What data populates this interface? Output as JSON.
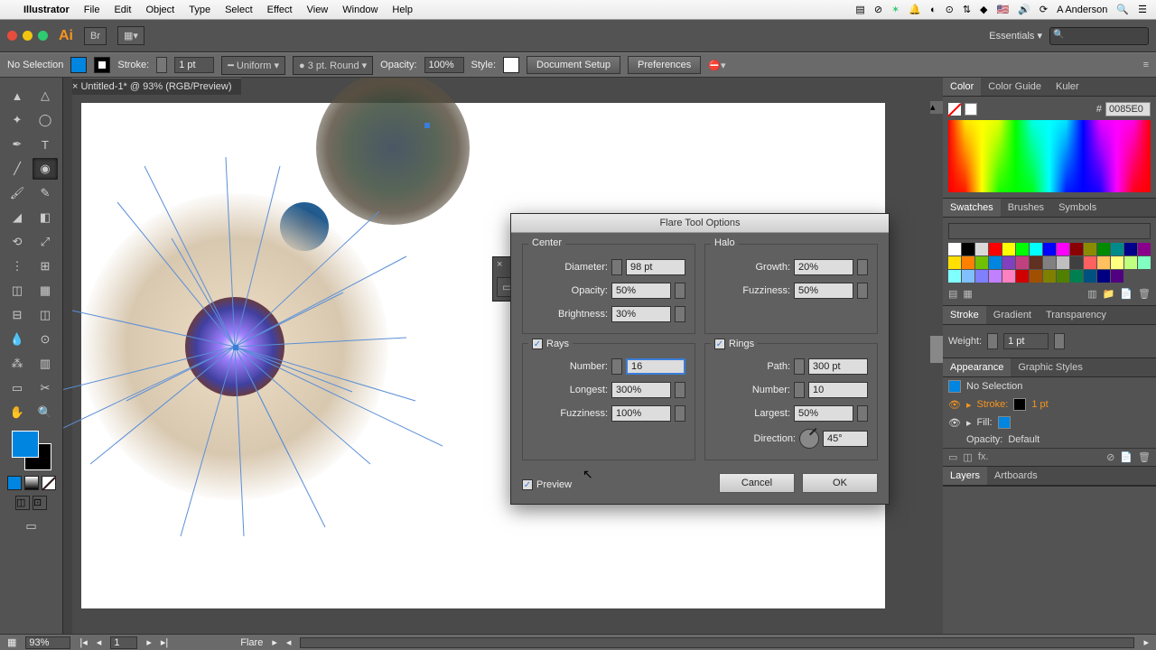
{
  "mac_menu": {
    "app": "Illustrator",
    "items": [
      "File",
      "Edit",
      "Object",
      "Type",
      "Select",
      "Effect",
      "View",
      "Window",
      "Help"
    ],
    "user": "A Anderson"
  },
  "app_toolbar": {
    "workspace": "Essentials"
  },
  "control_bar": {
    "selection": "No Selection",
    "stroke_label": "Stroke:",
    "stroke_weight": "1 pt",
    "stroke_style": "Uniform",
    "brush": "3 pt. Round",
    "opacity_label": "Opacity:",
    "opacity": "100%",
    "style_label": "Style:",
    "doc_setup": "Document Setup",
    "prefs": "Preferences"
  },
  "doc": {
    "tab": "Untitled-1* @ 93% (RGB/Preview)"
  },
  "dialog": {
    "title": "Flare Tool Options",
    "center": {
      "legend": "Center",
      "diameter_label": "Diameter:",
      "diameter": "98 pt",
      "opacity_label": "Opacity:",
      "opacity": "50%",
      "brightness_label": "Brightness:",
      "brightness": "30%"
    },
    "halo": {
      "legend": "Halo",
      "growth_label": "Growth:",
      "growth": "20%",
      "fuzziness_label": "Fuzziness:",
      "fuzziness": "50%"
    },
    "rays": {
      "legend": "Rays",
      "checked": true,
      "number_label": "Number:",
      "number": "16",
      "longest_label": "Longest:",
      "longest": "300%",
      "fuzziness_label": "Fuzziness:",
      "fuzziness": "100%"
    },
    "rings": {
      "legend": "Rings",
      "checked": true,
      "path_label": "Path:",
      "path": "300 pt",
      "number_label": "Number:",
      "number": "10",
      "largest_label": "Largest:",
      "largest": "50%",
      "direction_label": "Direction:",
      "direction": "45°"
    },
    "preview_label": "Preview",
    "cancel": "Cancel",
    "ok": "OK"
  },
  "panels": {
    "color": {
      "tabs": [
        "Color",
        "Color Guide",
        "Kuler"
      ],
      "hex": "0085E0"
    },
    "swatches": {
      "tabs": [
        "Swatches",
        "Brushes",
        "Symbols"
      ]
    },
    "stroke": {
      "tabs": [
        "Stroke",
        "Gradient",
        "Transparency"
      ],
      "weight_label": "Weight:",
      "weight": "1 pt"
    },
    "appearance": {
      "tabs": [
        "Appearance",
        "Graphic Styles"
      ],
      "selection": "No Selection",
      "stroke_label": "Stroke:",
      "stroke_val": "1 pt",
      "fill_label": "Fill:",
      "opacity_label": "Opacity:",
      "opacity_val": "Default"
    },
    "layers": {
      "tabs": [
        "Layers",
        "Artboards"
      ]
    }
  },
  "status": {
    "zoom": "93%",
    "artboard": "1",
    "tool": "Flare"
  },
  "swatch_colors": [
    "#ffffff",
    "#000000",
    "#d9d9d9",
    "#ff0000",
    "#ffff00",
    "#00ff00",
    "#00ffff",
    "#0000ff",
    "#ff00ff",
    "#8b0000",
    "#8b8b00",
    "#008b00",
    "#008b8b",
    "#00008b",
    "#8b008b",
    "#ffe000",
    "#ff8000",
    "#70c000",
    "#0085e0",
    "#8040c0",
    "#c04080",
    "#603020",
    "#808080",
    "#bfbfbf",
    "#404040",
    "#ff6060",
    "#ffc060",
    "#ffff80",
    "#c0ff80",
    "#80ffc0",
    "#80ffff",
    "#80c0ff",
    "#8080ff",
    "#c080ff",
    "#ff80c0",
    "#d00000",
    "#a05000",
    "#808000",
    "#508000",
    "#008050",
    "#005080",
    "#000080",
    "#500080"
  ]
}
